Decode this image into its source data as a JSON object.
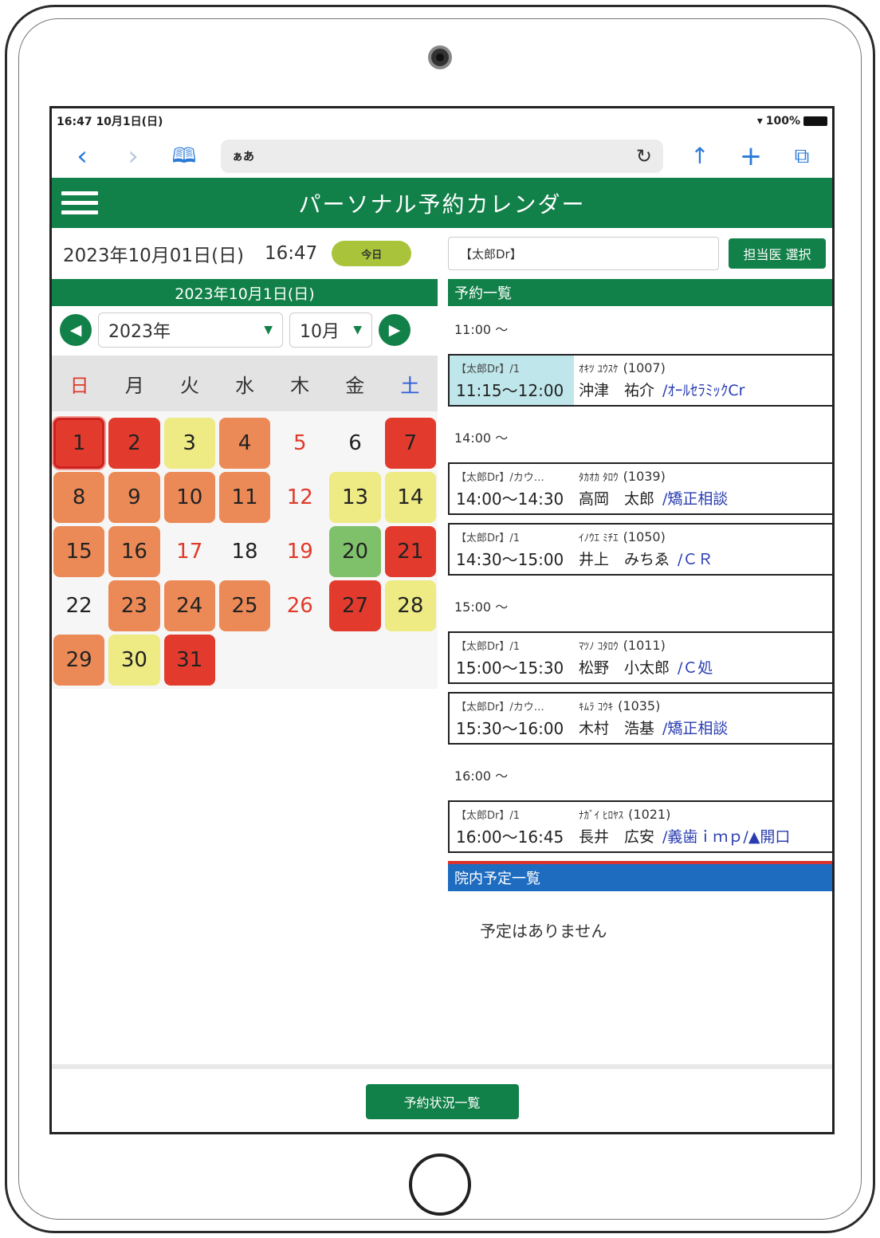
{
  "status": {
    "time": "16:47 10月1日(日)",
    "battery": "100%"
  },
  "browser": {
    "url": "ぁあ"
  },
  "app": {
    "title": "パーソナル予約カレンダー"
  },
  "left": {
    "current_date": "2023年10月01日(日)",
    "current_time": "16:47",
    "today_label": "今日",
    "selected_date": "2023年10月1日(日)",
    "year": "2023年",
    "month": "10月",
    "weekdays": [
      "日",
      "月",
      "火",
      "水",
      "木",
      "金",
      "土"
    ],
    "days": [
      {
        "d": "1",
        "s": "red",
        "sel": true
      },
      {
        "d": "2",
        "s": "red"
      },
      {
        "d": "3",
        "s": "yellow"
      },
      {
        "d": "4",
        "s": "orange"
      },
      {
        "d": "5",
        "s": "none",
        "h": true
      },
      {
        "d": "6",
        "s": "none"
      },
      {
        "d": "7",
        "s": "red"
      },
      {
        "d": "8",
        "s": "orange"
      },
      {
        "d": "9",
        "s": "orange"
      },
      {
        "d": "10",
        "s": "orange"
      },
      {
        "d": "11",
        "s": "orange"
      },
      {
        "d": "12",
        "s": "none",
        "h": true
      },
      {
        "d": "13",
        "s": "yellow"
      },
      {
        "d": "14",
        "s": "yellow"
      },
      {
        "d": "15",
        "s": "orange"
      },
      {
        "d": "16",
        "s": "orange"
      },
      {
        "d": "17",
        "s": "none",
        "h": true
      },
      {
        "d": "18",
        "s": "none"
      },
      {
        "d": "19",
        "s": "none",
        "h": true
      },
      {
        "d": "20",
        "s": "green"
      },
      {
        "d": "21",
        "s": "red"
      },
      {
        "d": "22",
        "s": "none"
      },
      {
        "d": "23",
        "s": "orange"
      },
      {
        "d": "24",
        "s": "orange"
      },
      {
        "d": "25",
        "s": "orange"
      },
      {
        "d": "26",
        "s": "none",
        "h": true
      },
      {
        "d": "27",
        "s": "red"
      },
      {
        "d": "28",
        "s": "yellow"
      },
      {
        "d": "29",
        "s": "orange"
      },
      {
        "d": "30",
        "s": "yellow"
      },
      {
        "d": "31",
        "s": "red"
      }
    ]
  },
  "right": {
    "doctor": "【太郎Dr】",
    "doctor_button": "担当医 選択",
    "list_title": "予約一覧",
    "groups": [
      {
        "time": "11:00 ～",
        "appts": [
          {
            "meta": "【太郎Dr】/1",
            "time": "11:15～12:00",
            "kana": "ｵｷﾂ ﾕｳｽｹ",
            "pid": "(1007)",
            "name": "沖津　祐介",
            "type": "/ｵｰﾙｾﾗﾐｯｸCr",
            "highlight": true
          }
        ]
      },
      {
        "time": "14:00 ～",
        "appts": [
          {
            "meta": "【太郎Dr】/カウ…",
            "time": "14:00～14:30",
            "kana": "ﾀｶｵｶ ﾀﾛｳ",
            "pid": "(1039)",
            "name": "高岡　太郎",
            "type": "/矯正相談"
          },
          {
            "meta": "【太郎Dr】/1",
            "time": "14:30～15:00",
            "kana": "ｲﾉｳｴ ﾐﾁｴ",
            "pid": "(1050)",
            "name": "井上　みちゑ",
            "type": "/ＣＲ"
          }
        ]
      },
      {
        "time": "15:00 ～",
        "appts": [
          {
            "meta": "【太郎Dr】/1",
            "time": "15:00～15:30",
            "kana": "ﾏﾂﾉ ｺﾀﾛｳ",
            "pid": "(1011)",
            "name": "松野　小太郎",
            "type": "/Ｃ処"
          },
          {
            "meta": "【太郎Dr】/カウ…",
            "time": "15:30～16:00",
            "kana": "ｷﾑﾗ ｺｳｷ",
            "pid": "(1035)",
            "name": "木村　浩基",
            "type": "/矯正相談"
          }
        ]
      },
      {
        "time": "16:00 ～",
        "appts": [
          {
            "meta": "【太郎Dr】/1",
            "time": "16:00～16:45",
            "kana": "ﾅｶﾞｲ ﾋﾛﾔｽ",
            "pid": "(1021)",
            "name": "長井　広安",
            "type": "/義歯ｉｍｐ/▲開口"
          }
        ]
      }
    ],
    "internal_title": "院内予定一覧",
    "no_events": "予定はありません"
  },
  "footer": {
    "button": "予約状況一覧"
  },
  "colors": {
    "brand_green": "#128049",
    "busy_red": "#e23b2e",
    "busy_orange": "#ec8a57",
    "busy_yellow": "#eeea84",
    "busy_green": "#7fc16b",
    "internal_blue": "#1e6cc0"
  }
}
